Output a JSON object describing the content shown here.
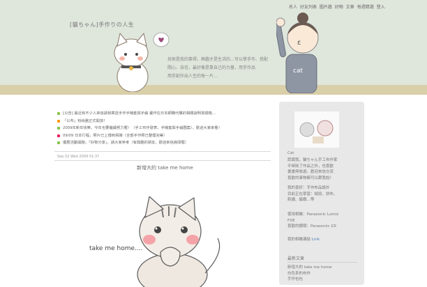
{
  "top_nav": [
    "名人",
    "好友列表",
    "圖片牆",
    "好物",
    "文章",
    "每週精選",
    "登入"
  ],
  "blog": {
    "title": "[貓ちゃん]手作りの人生",
    "desc_lines": [
      "技術是我的靠得，興趣才是生活的…可以學手作、搭配",
      "開心、自信，最好像是靠自己的力量，用手作品",
      "用手創作出人生的每一片…"
    ]
  },
  "news": [
    {
      "color": "#8bc34a",
      "text": "[公告] 最近有不少人來信請我寄送手作手機套與手繪 畫作在日本網購代購的相關說明與價格…"
    },
    {
      "color": "#ff9800",
      "text": "「公布」粉絲團正式開放！"
    },
    {
      "color": "#8bc34a",
      "text": "2009年新年快樂，今年也要繼續努力喔！（手工布作發表，手機套與手繪圖案），歡迎大家來看！"
    },
    {
      "color": "#e91e63",
      "text": "09/09 日本行程，照片已上傳到相簿（全部手作照已整理完畢）"
    },
    {
      "color": "#8bc34a",
      "text": "優惠活動開跑，「好物分享」，請大家參考（有興趣的朋友，歡迎來信詢問喔）"
    }
  ],
  "post": {
    "date": "Sep 02 Wed 2009 01:37",
    "title": "新增大的 take me home",
    "caption": "take me home...."
  },
  "sidebar": {
    "name": "Cat",
    "bio": [
      "認識我，貓ちゃん手工布作家",
      "平時除了作品之外，也喜歡",
      "畫畫與旅遊。歡迎來信交流",
      "喜歡的事物都可以跟我說！"
    ],
    "likes": [
      "我的喜好：手作布品設計",
      "目前正在學習：縫紉、拼布、",
      "刺繡、編織…等"
    ],
    "camera": [
      "使用相機：Panasonic Lumix",
      "FX8",
      "喜歡的鏡頭：Panasonic G5"
    ],
    "contact_label": "我的相機連結",
    "contact_link": "Link",
    "section_title": "最新文章",
    "recent": [
      "新增大的 take me home",
      "白色系的布作",
      "手作包包"
    ]
  }
}
